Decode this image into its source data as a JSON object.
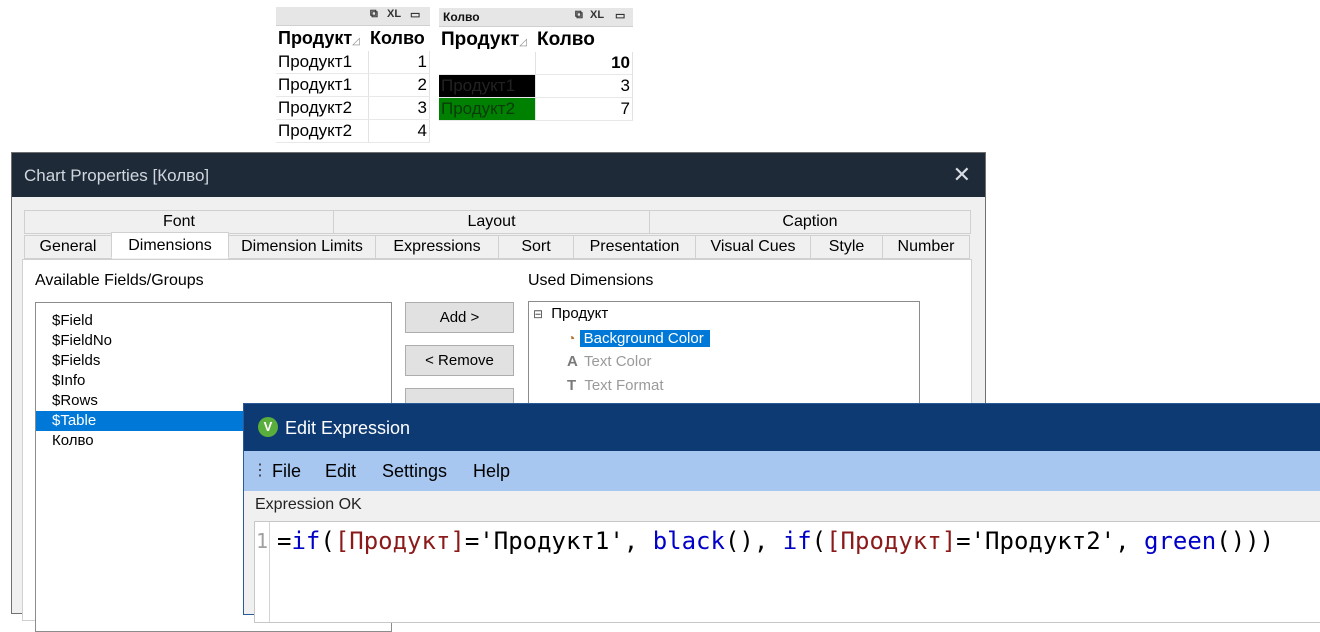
{
  "table1": {
    "icons": [
      "restore-icon",
      "xl-icon",
      "minimize-icon"
    ],
    "xl": "XL",
    "headers": [
      "Продукт",
      "Колво"
    ],
    "rows": [
      {
        "product": "Продукт1",
        "qty": "1"
      },
      {
        "product": "Продукт1",
        "qty": "2"
      },
      {
        "product": "Продукт2",
        "qty": "3"
      },
      {
        "product": "Продукт2",
        "qty": "4"
      }
    ]
  },
  "table2": {
    "caption": "Колво",
    "xl": "XL",
    "headers": [
      "Продукт",
      "Колво"
    ],
    "total": "10",
    "rows": [
      {
        "product": "Продукт1",
        "qty": "3",
        "bg": "#000000"
      },
      {
        "product": "Продукт2",
        "qty": "7",
        "bg": "#008000"
      }
    ]
  },
  "chart_properties": {
    "title": "Chart Properties [Колво]",
    "close": "✕",
    "tabs_top": [
      "Font",
      "Layout",
      "Caption"
    ],
    "tabs_bottom": [
      "General",
      "Dimensions",
      "Dimension Limits",
      "Expressions",
      "Sort",
      "Presentation",
      "Visual Cues",
      "Style",
      "Number"
    ],
    "active_tab": "Dimensions",
    "available_label": "Available Fields/Groups",
    "available_fields": [
      "$Field",
      "$FieldNo",
      "$Fields",
      "$Info",
      "$Rows",
      "$Table",
      "Колво"
    ],
    "selected_field": "$Table",
    "add_button": "Add >",
    "remove_button": "< Remove",
    "used_label": "Used Dimensions",
    "used_dimension": "Продукт",
    "expand_glyph": "⊟",
    "sub_items": [
      {
        "label": "Background Color",
        "icon": "palette-icon",
        "selected": true
      },
      {
        "label": "Text Color",
        "icon": "text-color-icon",
        "selected": false
      },
      {
        "label": "Text Format",
        "icon": "text-format-icon",
        "selected": false
      }
    ]
  },
  "edit_expression": {
    "title": "Edit Expression",
    "logo": "V",
    "menu": [
      "File",
      "Edit",
      "Settings",
      "Help"
    ],
    "status": "Expression OK",
    "line_number": "1",
    "code": {
      "p1": "=",
      "k1": "if",
      "p2": "(",
      "f1": "[Продукт]",
      "p3": "='Продукт1', ",
      "k2": "black",
      "p4": "(), ",
      "k3": "if",
      "p5": "(",
      "f2": "[Продукт]",
      "p6": "='Продукт2', ",
      "k4": "green",
      "p7": "()))"
    }
  }
}
